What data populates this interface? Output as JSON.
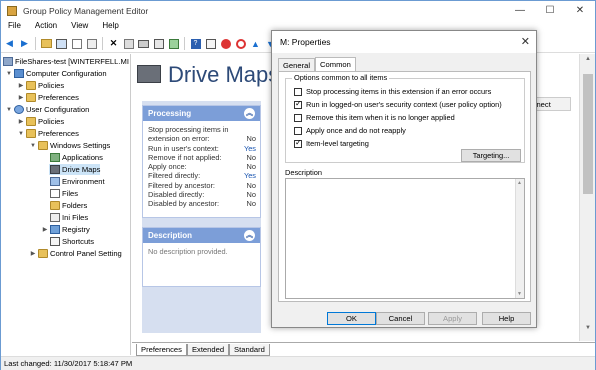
{
  "window": {
    "title": "Group Policy Management Editor",
    "controls": [
      "—",
      "☐",
      "✕"
    ]
  },
  "menu": [
    "File",
    "Action",
    "View",
    "Help"
  ],
  "tree": {
    "root": "FileShares-test [WINTERFELL.MI",
    "computer_config": "Computer Configuration",
    "cc_policies": "Policies",
    "cc_preferences": "Preferences",
    "user_config": "User Configuration",
    "uc_policies": "Policies",
    "uc_preferences": "Preferences",
    "windows_settings": "Windows Settings",
    "applications": "Applications",
    "drive_maps": "Drive Maps",
    "environment": "Environment",
    "files": "Files",
    "folders": "Folders",
    "ini_files": "Ini Files",
    "registry": "Registry",
    "shortcuts": "Shortcuts",
    "control_panel": "Control Panel Setting"
  },
  "banner_title": "Drive Maps",
  "processing": {
    "title": "Processing",
    "rows": [
      {
        "label": "Stop processing items in",
        "value": ""
      },
      {
        "label": "extension on error:",
        "value": "No"
      },
      {
        "label": "Run in user's context:",
        "value": "Yes"
      },
      {
        "label": "Remove if not applied:",
        "value": "No"
      },
      {
        "label": "Apply once:",
        "value": "No"
      },
      {
        "label": "Filtered directly:",
        "value": "Yes"
      },
      {
        "label": "Filtered by ancestor:",
        "value": "No"
      },
      {
        "label": "Disabled directly:",
        "value": "No"
      },
      {
        "label": "Disabled by ancestor:",
        "value": "No"
      }
    ]
  },
  "description_panel": {
    "title": "Description",
    "text": "No description provided."
  },
  "ghost_column": "onnect",
  "bottom_tabs": [
    "Preferences",
    "Extended",
    "Standard"
  ],
  "status": "Last changed: 11/30/2017 5:18:47 PM",
  "dialog": {
    "title": "M: Properties",
    "tabs": [
      "General",
      "Common"
    ],
    "group_label": "Options common to all items",
    "options": [
      {
        "label": "Stop processing items in this extension if an error occurs",
        "checked": false
      },
      {
        "label": "Run in logged-on user's security context (user policy option)",
        "checked": true
      },
      {
        "label": "Remove this item when it is no longer applied",
        "checked": false
      },
      {
        "label": "Apply once and do not reapply",
        "checked": false
      },
      {
        "label": "Item-level targeting",
        "checked": true
      }
    ],
    "targeting_button": "Targeting...",
    "description_label": "Description",
    "buttons": {
      "ok": "OK",
      "cancel": "Cancel",
      "apply": "Apply",
      "help": "Help"
    }
  }
}
